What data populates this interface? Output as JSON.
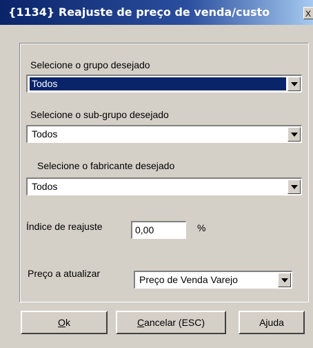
{
  "window": {
    "title": "{1134} Reajuste de preço de venda/custo",
    "close_glyph": "X"
  },
  "grupo": {
    "label": "Selecione o grupo desejado",
    "value": "Todos"
  },
  "subgrupo": {
    "label": "Selecione o sub-grupo desejado",
    "value": "Todos"
  },
  "fabricante": {
    "label": "Selecione o fabricante desejado",
    "value": "Todos"
  },
  "indice": {
    "label": "Índice de reajuste",
    "value": "0,00",
    "unit": "%"
  },
  "preco": {
    "label": "Preço a atualizar",
    "value": "Preço de Venda Varejo"
  },
  "buttons": {
    "ok_mnemonic": "O",
    "ok_rest": "k",
    "cancel_mnemonic": "C",
    "cancel_rest": "ancelar (ESC)",
    "help": "Ajuda"
  }
}
